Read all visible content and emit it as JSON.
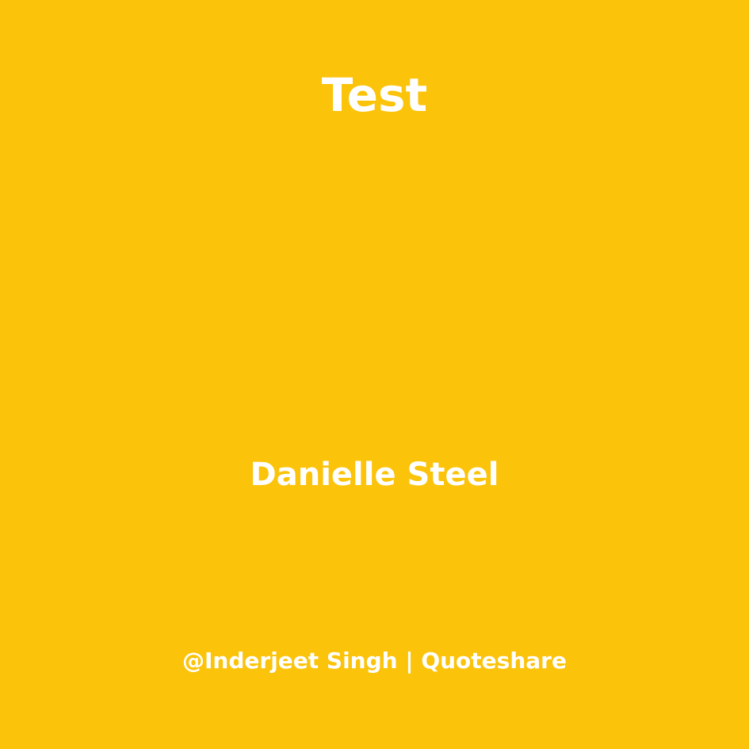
{
  "quote": {
    "text": "Test",
    "author": "Danielle Steel"
  },
  "footer": {
    "credit": "@Inderjeet Singh | Quoteshare"
  },
  "colors": {
    "background": "#FBC30A",
    "text": "#FFFFFF"
  }
}
